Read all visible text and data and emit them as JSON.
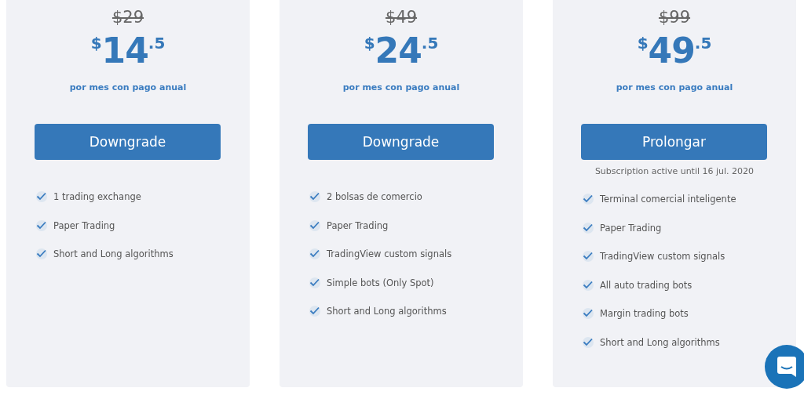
{
  "plans": [
    {
      "old_price": "$29",
      "price": {
        "currency": "$",
        "amount": "14",
        "fraction": ".5"
      },
      "period": "por mes con pago anual",
      "button": "Downgrade",
      "features": [
        "1 trading exchange",
        "Paper Trading",
        "Short and Long algorithms"
      ]
    },
    {
      "old_price": "$49",
      "price": {
        "currency": "$",
        "amount": "24",
        "fraction": ".5"
      },
      "period": "por mes con pago anual",
      "button": "Downgrade",
      "features": [
        "2 bolsas de comercio",
        "Paper Trading",
        "TradingView custom signals",
        "Simple bots (Only Spot)",
        "Short and Long algorithms"
      ]
    },
    {
      "old_price": "$99",
      "price": {
        "currency": "$",
        "amount": "49",
        "fraction": ".5"
      },
      "period": "por mes con pago anual",
      "button": "Prolongar",
      "note": "Subscription active until 16 jul. 2020",
      "features": [
        "Terminal comercial inteligente",
        "Paper Trading",
        "TradingView custom signals",
        "All auto trading bots",
        "Margin trading bots",
        "Short and Long algorithms"
      ]
    }
  ]
}
